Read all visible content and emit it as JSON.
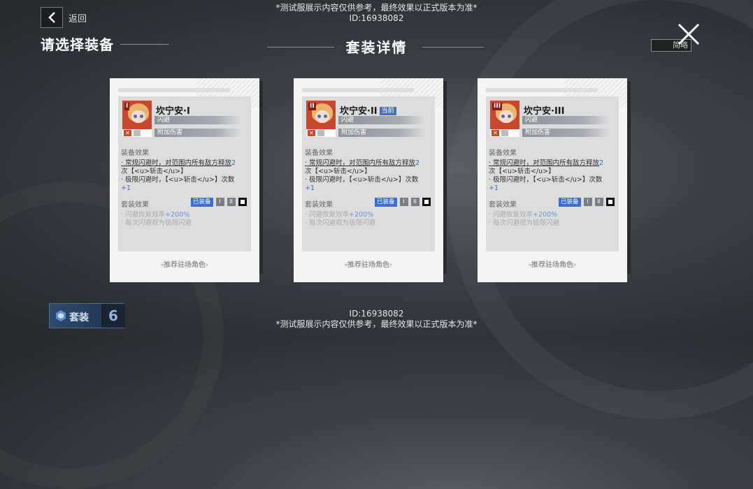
{
  "watermark": {
    "notice": "*测试服展示内容仅供参考，最终效果以正式版本为准*",
    "id": "ID:16938082"
  },
  "header": {
    "back_label": "返回",
    "page_title": "请选择装备",
    "modal_title": "套装详情",
    "simple_toggle_label": "简略"
  },
  "cards": [
    {
      "rank": "I",
      "name": "坎宁安·I",
      "current_badge": "",
      "tags": [
        "闪避",
        "附加伤害"
      ],
      "equip_effect_label": "装备效果",
      "effect_1a": "· 常规闪避时，对范围内所有敌方释放",
      "effect_1b": "2",
      "effect_1c": "次【<u>斩击</u>】",
      "effect_2a": "· 极限闪避时，【<u>斩击</u>】次数",
      "effect_2b": "+1",
      "set_effect_label": "套装效果",
      "equipped_badge": "已装备",
      "levels": [
        "I",
        "II",
        "III"
      ],
      "set_effect_1a": "· 闪避恢复效率",
      "set_effect_1b": "+200%",
      "set_effect_2": "· 每次闪避视为极限闪避",
      "recommend": "-推荐驻场角色-",
      "recommend_bg": "RECOMMEND"
    },
    {
      "rank": "II",
      "name": "坎宁安·II",
      "current_badge": "当前",
      "tags": [
        "闪避",
        "附加伤害"
      ],
      "equip_effect_label": "装备效果",
      "effect_1a": "· 常规闪避时，对范围内所有敌方释放",
      "effect_1b": "2",
      "effect_1c": "次【<u>斩击</u>】",
      "effect_2a": "· 极限闪避时，【<u>斩击</u>】次数",
      "effect_2b": "+1",
      "set_effect_label": "套装效果",
      "equipped_badge": "已装备",
      "levels": [
        "I",
        "II",
        "III"
      ],
      "set_effect_1a": "· 闪避恢复效率",
      "set_effect_1b": "+200%",
      "set_effect_2": "· 每次闪避视为极限闪避",
      "recommend": "-推荐驻场角色-",
      "recommend_bg": "RECOMMEND"
    },
    {
      "rank": "III",
      "name": "坎宁安·III",
      "current_badge": "",
      "tags": [
        "闪避",
        "附加伤害"
      ],
      "equip_effect_label": "装备效果",
      "effect_1a": "· 常规闪避时，对范围内所有敌方释放",
      "effect_1b": "2",
      "effect_1c": "次【<u>斩击</u>】",
      "effect_2a": "· 极限闪避时，【<u>斩击</u>】次数",
      "effect_2b": "+1",
      "set_effect_label": "套装效果",
      "equipped_badge": "已装备",
      "levels": [
        "I",
        "II",
        "III"
      ],
      "set_effect_1a": "· 闪避恢复效率",
      "set_effect_1b": "+200%",
      "set_effect_2": "· 每次闪避视为极限闪避",
      "recommend": "-推荐驻场角色-",
      "recommend_bg": "RECOMMEND"
    }
  ],
  "footer": {
    "set_label": "套装",
    "set_count": "6"
  },
  "colors": {
    "accent_blue": "#3b6fd6",
    "portrait_red": "#c7482f",
    "card_bg": "#f4f4f4"
  }
}
